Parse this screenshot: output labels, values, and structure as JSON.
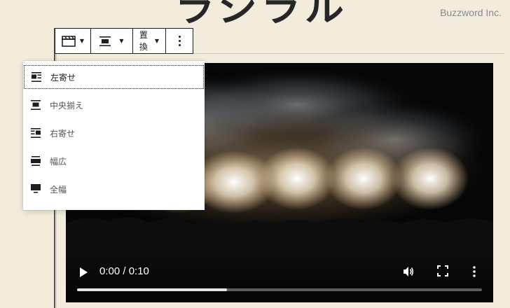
{
  "page": {
    "title_fragment": "ラシラル",
    "site_credit": "Buzzword Inc."
  },
  "toolbar": {
    "video_block": {
      "icon": "film-clapper-icon"
    },
    "align": {
      "icon": "align-center-icon"
    },
    "replace_label": "置換",
    "more": {
      "icon": "more-vertical-icon"
    }
  },
  "align_menu": {
    "items": [
      {
        "label": "左寄せ",
        "icon": "align-left-icon",
        "selected": true
      },
      {
        "label": "中央揃え",
        "icon": "align-center-icon",
        "selected": false
      },
      {
        "label": "右寄せ",
        "icon": "align-right-icon",
        "selected": false
      },
      {
        "label": "幅広",
        "icon": "align-wide-icon",
        "selected": false
      },
      {
        "label": "全幅",
        "icon": "align-full-icon",
        "selected": false
      }
    ]
  },
  "video_player": {
    "time": "0:00 / 0:10",
    "progress_buffered": 0.37,
    "controls": [
      "play-icon",
      "volume-icon",
      "fullscreen-icon",
      "more-vertical-icon"
    ]
  },
  "colors": {
    "page_background": "#f2ecdc",
    "toolbar_border": "#1e1e1e",
    "text": "#1e1e1e",
    "credit": "#8a8a8a"
  }
}
